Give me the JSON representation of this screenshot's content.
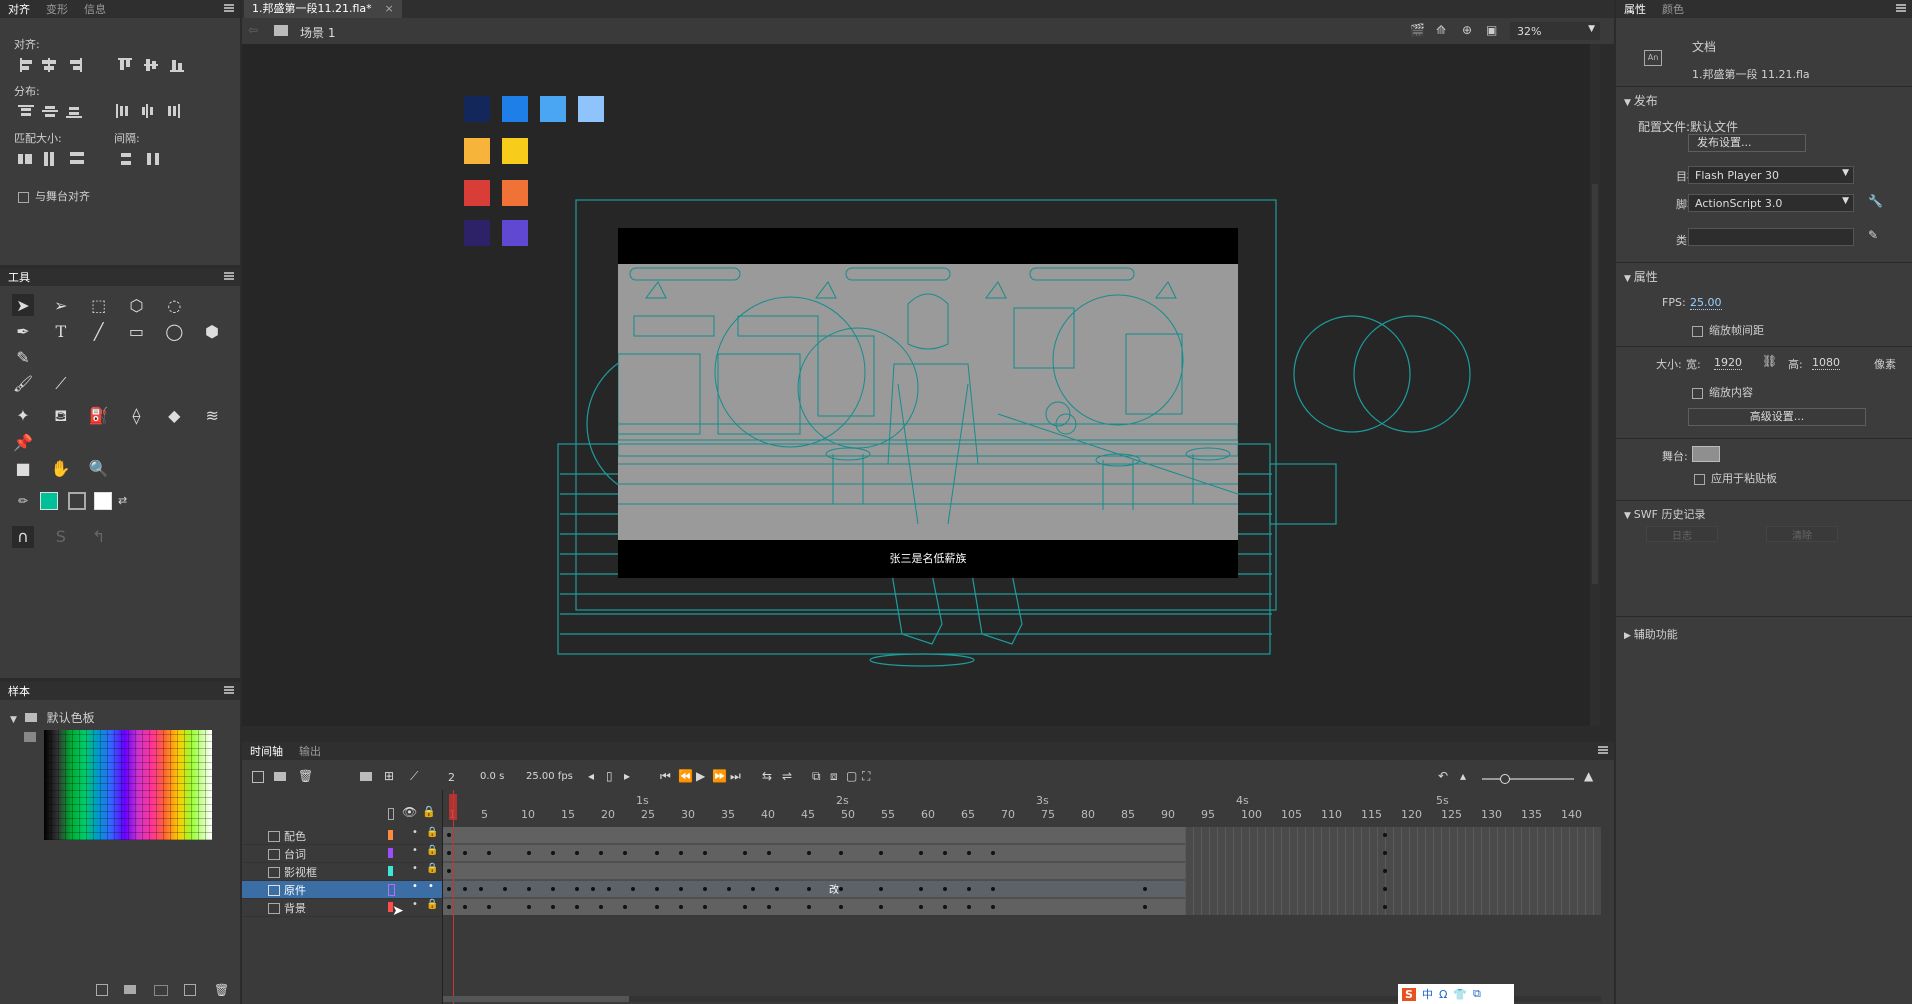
{
  "left_top_panel": {
    "tabs": [
      "对齐",
      "变形",
      "信息"
    ],
    "align_label": "对齐:",
    "distribute_label": "分布:",
    "match_size_label": "匹配大小:",
    "spacing_label": "间隔:",
    "align_to_stage_label": "与舞台对齐"
  },
  "tools_panel": {
    "title": "工具"
  },
  "swatches_panel": {
    "title": "样本",
    "folder_label": "默认色板"
  },
  "document_tab": {
    "title": "1.邦盛第一段11.21.fla*"
  },
  "edit_bar": {
    "scene_label": "场景 1",
    "zoom": "32%"
  },
  "stage": {
    "subtitle": "张三是名低薪族",
    "palette_colors": [
      "#14275a",
      "#1e7fe8",
      "#4aa6f3",
      "#8ec3fb",
      "#f6b43a",
      "#f8cc1a",
      "#d93d37",
      "#f07237",
      "#2d2268",
      "#6148d2"
    ]
  },
  "properties_panel": {
    "tabs": [
      "属性",
      "颜色"
    ],
    "doc_type": "文档",
    "doc_name": "1.邦盛第一段 11.21.fla",
    "publish_section": "发布",
    "profile_label": "配置文件:",
    "profile_value": "默认文件",
    "publish_settings_button": "发布设置...",
    "target_label": "目标:",
    "target_value": "Flash Player 30",
    "script_label": "脚本:",
    "script_value": "ActionScript 3.0",
    "class_label": "类:",
    "properties_section": "属性",
    "fps_label": "FPS:",
    "fps_value": "25.00",
    "scale_spans_label": "缩放帧间距",
    "size_label": "大小:",
    "width_label": "宽:",
    "width_value": "1920",
    "height_label": "高:",
    "height_value": "1080",
    "unit_label": "像素",
    "scale_content_label": "缩放内容",
    "advanced_button": "高级设置...",
    "stage_label": "舞台:",
    "apply_pasteboard_label": "应用于粘贴板",
    "swf_history_section": "SWF 历史记录",
    "log_button": "日志",
    "clear_button": "清除",
    "accessibility_section": "辅助功能"
  },
  "timeline": {
    "tabs": [
      "时间轴",
      "输出"
    ],
    "current_frame": "2",
    "time": "0.0 s",
    "fps": "25.00 fps",
    "seconds_markers": [
      "1s",
      "2s",
      "3s",
      "4s",
      "5s"
    ],
    "frame_numbers": [
      "1",
      "5",
      "10",
      "15",
      "20",
      "25",
      "30",
      "35",
      "40",
      "45",
      "50",
      "55",
      "60",
      "65",
      "70",
      "75",
      "80",
      "85",
      "90",
      "95",
      "100",
      "105",
      "110",
      "115",
      "120",
      "125",
      "130",
      "135",
      "140"
    ],
    "layers": [
      {
        "name": "配色",
        "color": "#ff8a3d",
        "selected": false
      },
      {
        "name": "台词",
        "color": "#9b4dff",
        "selected": false
      },
      {
        "name": "影视框",
        "color": "#3ee6d8",
        "selected": false
      },
      {
        "name": "原件",
        "color": "#b86bff",
        "selected": true
      },
      {
        "name": "背景",
        "color": "#ff4d4d",
        "selected": false
      }
    ],
    "frame_label_text": "改"
  },
  "ime_bar": {
    "items": [
      "S",
      "中",
      "Ω",
      "👕",
      "⧉"
    ]
  }
}
